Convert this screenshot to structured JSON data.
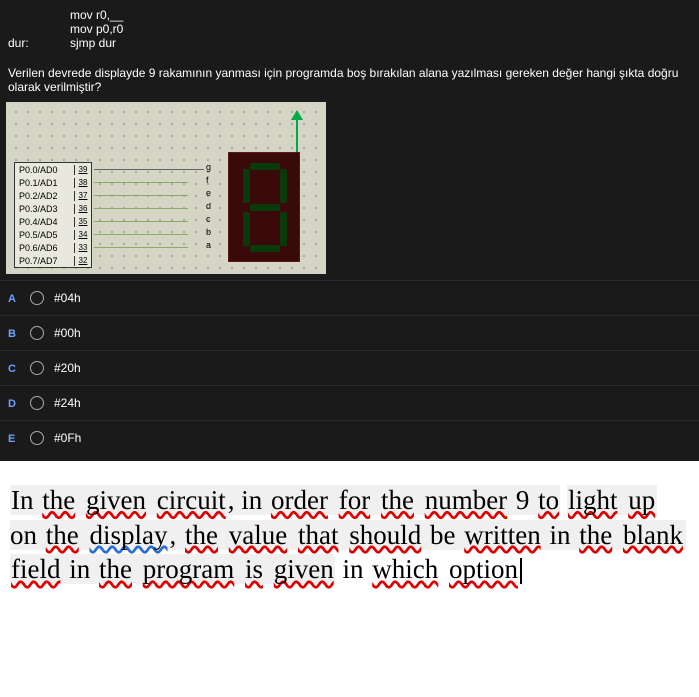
{
  "code": {
    "line1_label": "",
    "line1_text": "mov r0,__",
    "line2_label": "",
    "line2_text": "mov p0,r0",
    "line3_label": "dur:",
    "line3_text": "sjmp dur"
  },
  "question": "Verilen devrede displayde 9 rakamının yanması için programda boş bırakılan alana yazılması gereken değer hangi şıkta doğru olarak verilmiştir?",
  "circuit": {
    "pins": [
      {
        "label": "P0.0/AD0",
        "num": "39",
        "seg": "g"
      },
      {
        "label": "P0.1/AD1",
        "num": "38",
        "seg": "f"
      },
      {
        "label": "P0.2/AD2",
        "num": "37",
        "seg": "e"
      },
      {
        "label": "P0.3/AD3",
        "num": "36",
        "seg": "d"
      },
      {
        "label": "P0.4/AD4",
        "num": "35",
        "seg": "c"
      },
      {
        "label": "P0.5/AD5",
        "num": "34",
        "seg": "b"
      },
      {
        "label": "P0.6/AD6",
        "num": "33",
        "seg": "a"
      },
      {
        "label": "P0.7/AD7",
        "num": "32",
        "seg": ""
      }
    ]
  },
  "options": {
    "A": "#04h",
    "B": "#00h",
    "C": "#20h",
    "D": "#24h",
    "E": "#0Fh"
  },
  "translation": {
    "t1": "In ",
    "t2": "the",
    "t3": " ",
    "t4": "given",
    "t5": " ",
    "t6": "circuit",
    "t7": ", in ",
    "t8": "order",
    "t9": " ",
    "t10": "for",
    "t11": " ",
    "t12": "the",
    "t13": " ",
    "t14": "number",
    "t15": " 9 ",
    "t16": "to",
    "t17": " ",
    "t18": "light",
    "t19": " ",
    "t20": "up",
    "t21": " on ",
    "t22": "the",
    "t23": " ",
    "t24": "display",
    "t25": ", ",
    "t26": "the",
    "t27": " ",
    "t28": "value",
    "t29": " ",
    "t30": "that",
    "t31": " ",
    "t32": "should",
    "t33": " be ",
    "t34": "written",
    "t35": " in ",
    "t36": "the",
    "t37": " ",
    "t38": "blank",
    "t39": " ",
    "t40": "field",
    "t41": " in ",
    "t42": "the",
    "t43": " ",
    "t44": "program",
    "t45": " ",
    "t46": "is",
    "t47": " ",
    "t48": "given",
    "t49": " in ",
    "t50": "which",
    "t51": " ",
    "t52": "option"
  }
}
